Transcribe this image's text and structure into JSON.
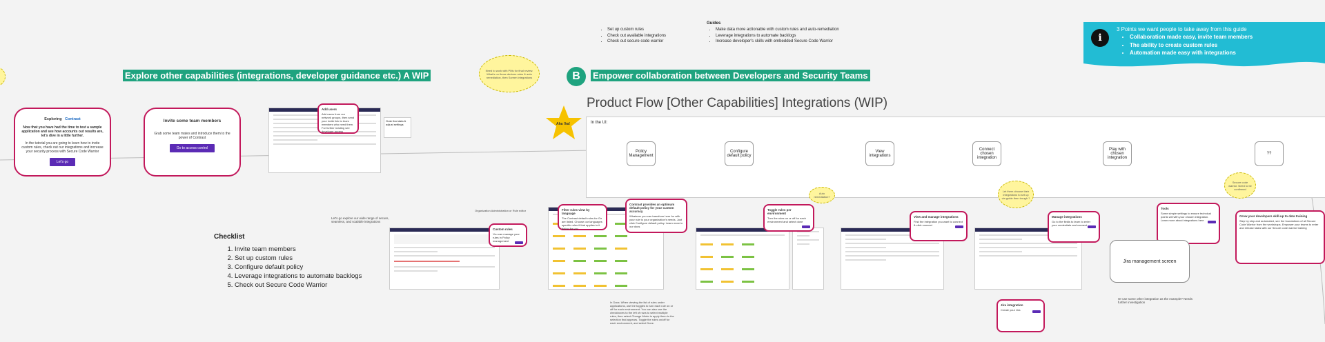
{
  "left_section": {
    "title": "Explore other capabilities (integrations, developer guidance etc.) A WIP",
    "card1": {
      "heading": "Exploring",
      "brand": "Contrast",
      "body_bold": "Now that you have had the time to test a sample application and see how accounts out results are, let's dive in a little further.",
      "body": "In the tutorial you are going to learn how to invite custom rules, check out our integrations and increase your security process with Secure Code Warrior",
      "button": "Let's go"
    },
    "card2": {
      "heading": "Invite some team members",
      "body": "Grab some team mates and introduce them to the power of Contrast",
      "button": "Go to access control"
    },
    "callout1": {
      "title": "Add users",
      "body": "Add users from our network groups, then send your invite link to team members who need them. For further reading see developer access"
    },
    "note_right": "Grab that data & adjust settings",
    "caption_left": "Let's go explore our wide range of secure, seamless, and scalable integrations",
    "caption_org": "Organization Administration or Rule editor",
    "callout2": {
      "title": "Custom rules",
      "body": "You can manage your rules in Policy management"
    },
    "checklist": {
      "title": "Checklist",
      "items": [
        "Invite team members",
        "Set up custom rules",
        "Configure default policy",
        "Leverage integrations to automate backlogs",
        "Check out Secure Code Warrior"
      ]
    }
  },
  "top_lists": {
    "list1": [
      "Set up custom rules",
      "Check out available integrations",
      "Check out secure code warrior"
    ],
    "guides_title": "Guides",
    "list2": [
      "Make data more actionable with custom rules and auto-remediation",
      "Leverage integrations to automate backlogs",
      "Increase developer's skills with embedded Secure Code Warrior"
    ]
  },
  "takeaway": {
    "title": "3 Points we want people to take away from this guide",
    "points": [
      "Collaboration made easy, invite team members",
      "The ability to create custom rules",
      "Automation made easy with integrations"
    ],
    "color": "#22bcd4"
  },
  "section_b": {
    "badge": "B",
    "title": "Empower collaboration between Developers and Security Teams",
    "flow_title": "Product Flow [Other Capabilities] Integrations (WIP)",
    "aha": "Aha !ha!",
    "in_ui": "In the UI:",
    "steps": [
      "Policy Management",
      "Configure default policy",
      "View integrations",
      "Connect chosen integration",
      "Play with chosen integration",
      "??"
    ]
  },
  "clouds": {
    "c1": "Need to work with PMs for final review. What's on those devices rules & auto remediation, then Screen integrations",
    "c2": "Auto remediation?",
    "c3": "Let them choose their integrations to set up via guide then trough ?",
    "c4": "Secure code warrior. Need to be confirmed"
  },
  "callouts_b": [
    {
      "title": "Filter rules view by language",
      "body": "The Contrast default rules for Go are listed. Choose our languages specific rules if that applies to it below for you"
    },
    {
      "title": "Contrast provides an optimum default policy for your custom accuracy",
      "body": "Whatever you can transform here for with your rule to your organization's needs. Just click Configure default policy. Learn more in our docs"
    },
    {
      "title": "Toggle rules per environment",
      "body": "Turn the rules on or off for each environment and select done"
    },
    {
      "title": "View and manage integrations",
      "body": "Find the integration you want to connect & click connect"
    },
    {
      "title": "Manage integrations",
      "body": "Go to the fields to learn to enter your credentials and connect"
    },
    {
      "title": "Tools",
      "body": "Some simple settings to ensure technical points will with your chosen integration. Learn more about integrations here"
    },
    {
      "title": "Grow your developers skill-up to data training",
      "body": "Step by step and automated, see the foundations of all Secure Code Warrior from the workshops. Empower your teams to enter and release tasks with our Secure code warrior training"
    },
    {
      "title": "Jira integration",
      "body": "Create your Jira"
    }
  ],
  "jira_screen": "Jira management screen",
  "bottom_note": "Or use some other integration as the example? Needs further investigation",
  "bottom_text_b": "In Docs: When viewing the list of rules under Applications, use the toggles to turn each rule on or off for each environment. You can also use the checkboxes to the left of rows to select multiple rules, then select Change Mode to apply them to the selection that appears. Toggle the rules on/off for each environment, and select Done."
}
